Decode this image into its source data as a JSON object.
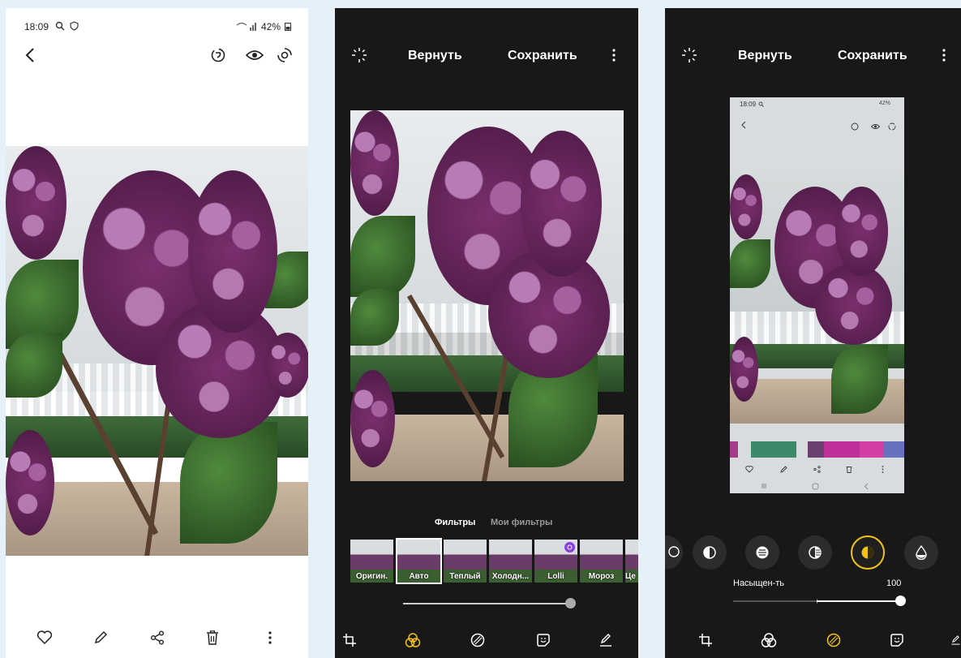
{
  "colors": {
    "accent": "#f2c21b",
    "dark_bg": "#181818",
    "white": "#ffffff"
  },
  "viewer": {
    "status_time": "18:09",
    "battery": "42%",
    "icons": [
      "back-icon",
      "bixby-vision-icon",
      "eye-icon",
      "remaster-icon"
    ],
    "bottom_icons": [
      "heart-icon",
      "pencil-icon",
      "share-icon",
      "trash-icon",
      "more-icon"
    ]
  },
  "editor_filters": {
    "revert_label": "Вернуть",
    "save_label": "Сохранить",
    "tabs": [
      "Фильтры",
      "Мои фильтры"
    ],
    "filters": [
      "Оригин.",
      "Авто",
      "Теплый",
      "Холодн...",
      "Lolli",
      "Мороз",
      "Це"
    ],
    "selected_filter": "Авто",
    "intensity": 1.0
  },
  "editor_adjust": {
    "revert_label": "Вернуть",
    "save_label": "Сохранить",
    "preview_time": "18:09",
    "preview_battery": "42%",
    "adjust_label": "Насыщен-ть",
    "adjust_value": "100",
    "adjust_level": 1.0
  }
}
